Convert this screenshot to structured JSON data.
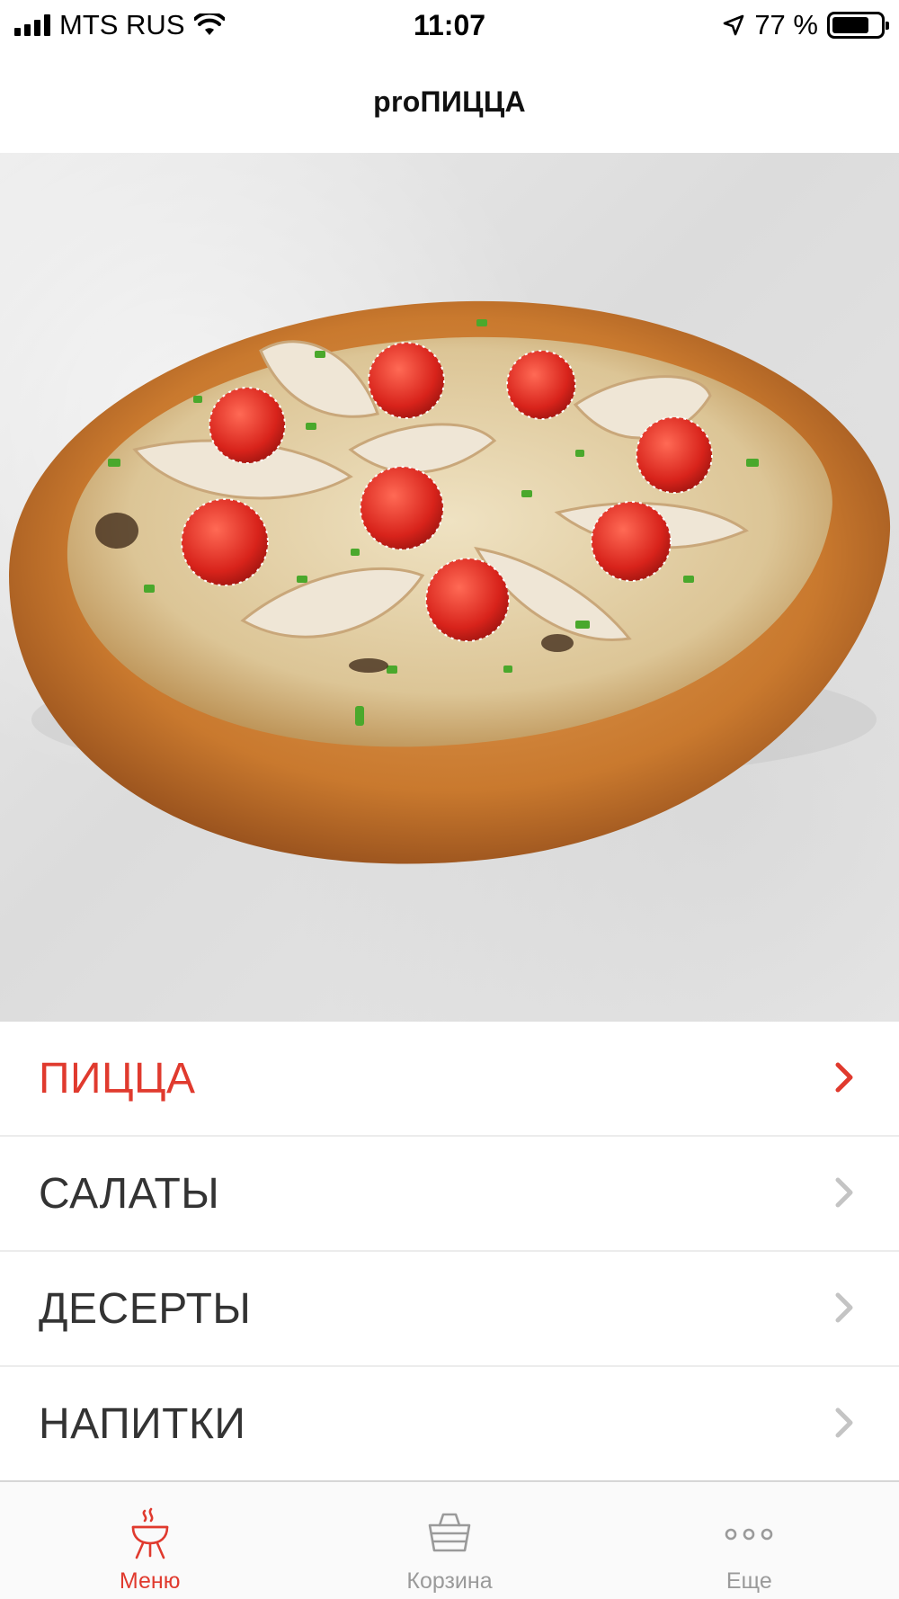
{
  "status_bar": {
    "carrier": "MTS RUS",
    "time": "11:07",
    "battery_percent": "77 %",
    "battery_level": 0.77
  },
  "nav": {
    "title": "proПИЦЦА"
  },
  "hero": {
    "image": "pizza-photo"
  },
  "categories": [
    {
      "label": "ПИЦЦА",
      "active": true
    },
    {
      "label": "САЛАТЫ",
      "active": false
    },
    {
      "label": "ДЕСЕРТЫ",
      "active": false
    },
    {
      "label": "НАПИТКИ",
      "active": false
    }
  ],
  "tabs": [
    {
      "label": "Меню",
      "icon": "grill-icon",
      "active": true
    },
    {
      "label": "Корзина",
      "icon": "basket-icon",
      "active": false
    },
    {
      "label": "Еще",
      "icon": "more-icon",
      "active": false
    }
  ],
  "colors": {
    "accent": "#e03a2e",
    "inactive": "#9a9a9a",
    "chevron_inactive": "#c4c4c4"
  }
}
